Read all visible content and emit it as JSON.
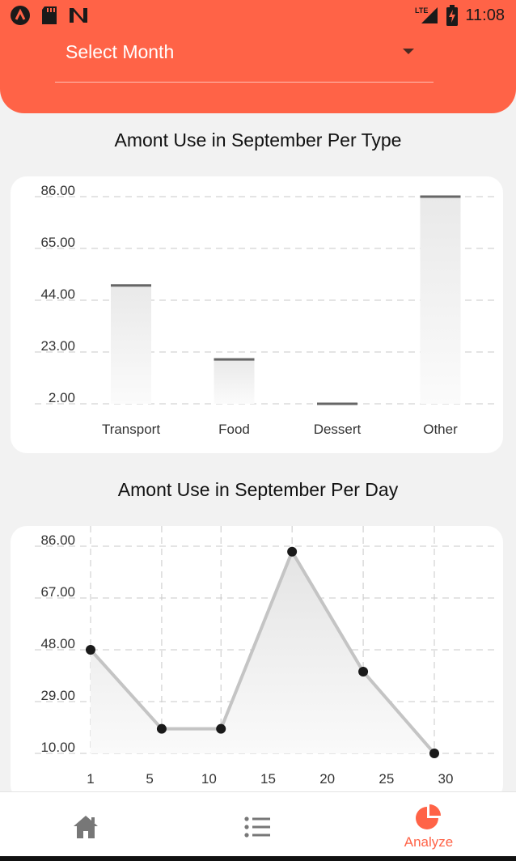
{
  "status_bar": {
    "time": "11:08",
    "network": "LTE",
    "left_icons": [
      "app-icon",
      "sd-card-icon",
      "n-logo-icon"
    ],
    "right_icons": [
      "signal-icon",
      "battery-charging-icon"
    ]
  },
  "header": {
    "background_color": "#ff6347",
    "select_label": "Select Month"
  },
  "type_section": {
    "title": "Amont Use in September Per Type"
  },
  "day_section": {
    "title": "Amont Use in September Per Day"
  },
  "chart_data": [
    {
      "type": "bar",
      "title": "Amont Use in September Per Type",
      "categories": [
        "Transport",
        "Food",
        "Dessert",
        "Other"
      ],
      "values": [
        50,
        20,
        2,
        86
      ],
      "y_ticks": [
        "86.00",
        "65.00",
        "44.00",
        "23.00",
        "2.00"
      ],
      "ylim": [
        2,
        86
      ],
      "grid": true
    },
    {
      "type": "line",
      "title": "Amont Use in September Per Day",
      "x": [
        1,
        7,
        12,
        18,
        24,
        30
      ],
      "y": [
        48,
        19,
        19,
        84,
        40,
        10
      ],
      "x_ticks": [
        "1",
        "5",
        "10",
        "15",
        "20",
        "25",
        "30"
      ],
      "y_ticks": [
        "86.00",
        "67.00",
        "48.00",
        "29.00",
        "10.00"
      ],
      "xlim": [
        1,
        30
      ],
      "ylim": [
        10,
        86
      ],
      "grid": true
    }
  ],
  "bottom_nav": {
    "items": [
      {
        "icon": "home-icon",
        "label": ""
      },
      {
        "icon": "list-icon",
        "label": ""
      },
      {
        "icon": "pie-chart-icon",
        "label": "Analyze"
      }
    ],
    "active_color": "#ff6347"
  }
}
